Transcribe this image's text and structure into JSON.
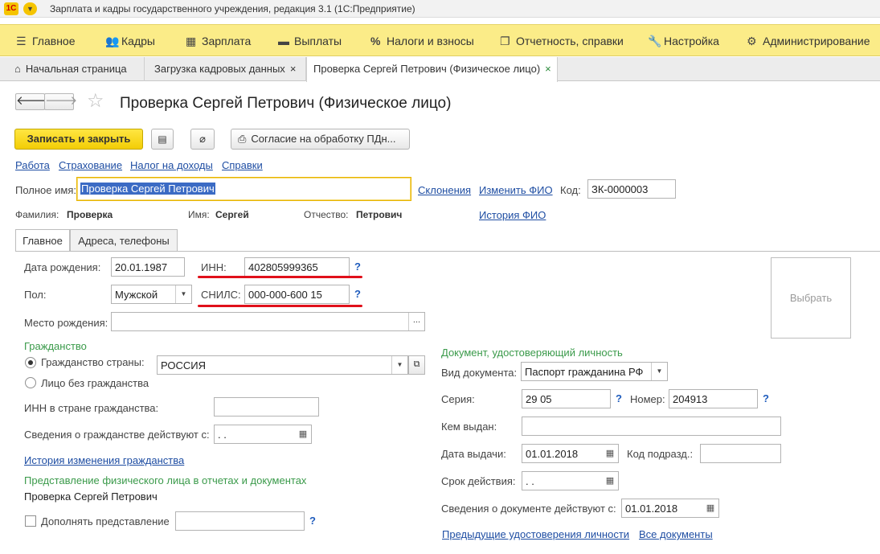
{
  "window": {
    "title": "Зарплата и кадры государственного учреждения, редакция 3.1  (1С:Предприятие)",
    "logo": "1С"
  },
  "main_menu": [
    {
      "icon": "☰",
      "label": "Главное"
    },
    {
      "icon": "👥",
      "label": "Кадры"
    },
    {
      "icon": "▦",
      "label": "Зарплата"
    },
    {
      "icon": "▬",
      "label": "Выплаты"
    },
    {
      "icon": "%",
      "label": "Налоги и взносы"
    },
    {
      "icon": "❐",
      "label": "Отчетность, справки"
    },
    {
      "icon": "🔧",
      "label": "Настройка"
    },
    {
      "icon": "⚙",
      "label": "Администрирование"
    }
  ],
  "tabs": [
    {
      "icon": "⌂",
      "label": "Начальная страница"
    },
    {
      "label": "Загрузка кадровых данных",
      "close": "×"
    },
    {
      "label": "Проверка Сергей Петрович (Физическое лицо)",
      "close": "×"
    }
  ],
  "form": {
    "title": "Проверка Сергей Петрович (Физическое лицо)",
    "back": "🡐",
    "forward": "🡒",
    "star": "☆",
    "save_close": "Записать и закрыть",
    "consent_button": "Согласие на обработку ПДн...",
    "links": [
      "Работа",
      "Страхование",
      "Налог на доходы",
      "Справки"
    ],
    "full_name_label": "Полное имя:",
    "full_name_value": "Проверка Сергей Петрович",
    "declension_link": "Склонения",
    "change_fio_link": "Изменить ФИО",
    "code_label": "Код:",
    "code_value": "ЗК-0000003",
    "surname_label": "Фамилия:",
    "surname_value": "Проверка",
    "name_label": "Имя:",
    "name_value": "Сергей",
    "patronymic_label": "Отчество:",
    "patronymic_value": "Петрович",
    "history_fio_link": "История ФИО"
  },
  "form_tabs": [
    "Главное",
    "Адреса, телефоны"
  ],
  "main_tab": {
    "birth_date_label": "Дата рождения:",
    "birth_date_value": "20.01.1987",
    "inn_label": "ИНН:",
    "inn_value": "402805999365",
    "sex_label": "Пол:",
    "sex_value": "Мужской",
    "snils_label": "СНИЛС:",
    "snils_value": "000-000-600 15",
    "birth_place_label": "Место рождения:",
    "birth_place_value": "",
    "photo_label": "Выбрать",
    "citizenship_section": "Гражданство",
    "citizenship_country_label": "Гражданство страны:",
    "citizenship_country_value": "РОССИЯ",
    "stateless_label": "Лицо без гражданства",
    "inn_citizenship_label": "ИНН в стране гражданства:",
    "citizenship_from_label": "Сведения о гражданстве действуют с:",
    "citizenship_from_value": " .  .",
    "citizenship_history_link": "История изменения гражданства",
    "representation_section": "Представление физического лица в отчетах и документах",
    "representation_value": "Проверка Сергей Петрович",
    "extend_representation_label": "Дополнять представление",
    "id_section": "Документ, удостоверяющий личность",
    "doc_type_label": "Вид документа:",
    "doc_type_value": "Паспорт гражданина РФ",
    "series_label": "Серия:",
    "series_value": "29 05",
    "number_label": "Номер:",
    "number_value": "204913",
    "issued_by_label": "Кем выдан:",
    "issued_by_value": "",
    "issue_date_label": "Дата выдачи:",
    "issue_date_value": "01.01.2018",
    "division_code_label": "Код подразд.:",
    "division_code_value": "",
    "validity_label": "Срок действия:",
    "validity_value": " .  .",
    "doc_valid_from_label": "Сведения о документе действуют с:",
    "doc_valid_from_value": "01.01.2018",
    "prev_docs_link": "Предыдущие удостоверения личности",
    "all_docs_link": "Все документы",
    "help": "?"
  },
  "colors": {
    "menu_bg": "#fbec88",
    "primary_btn": "#f5d31a",
    "section_green": "#3a9a4a",
    "link_blue": "#1f4ea3",
    "highlight_red": "#e0101a"
  }
}
